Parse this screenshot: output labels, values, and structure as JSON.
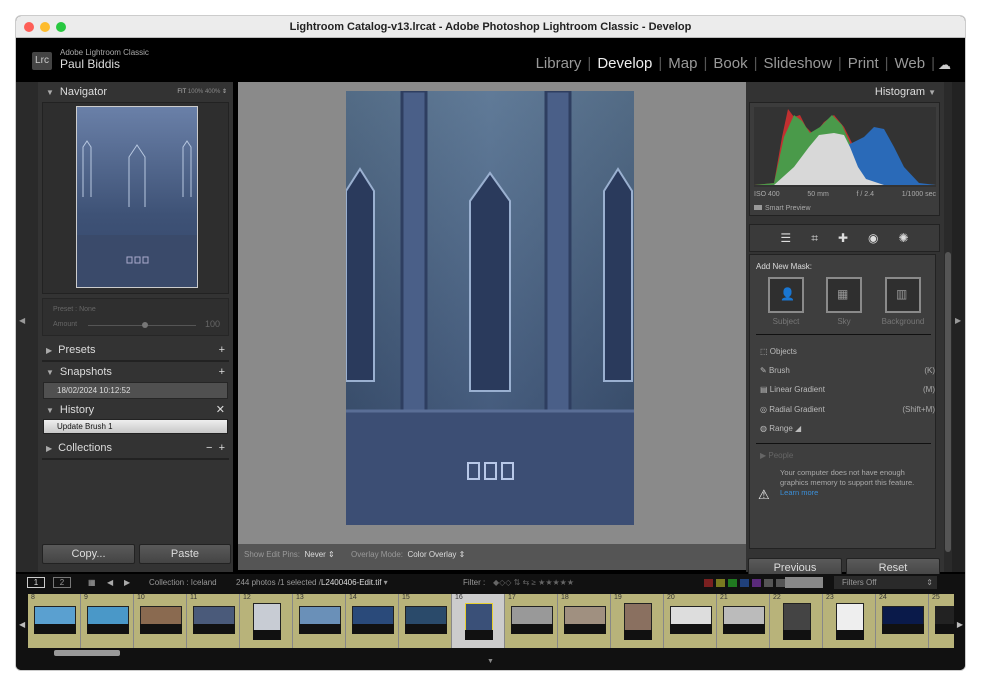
{
  "window": {
    "title": "Lightroom Catalog-v13.lrcat - Adobe Photoshop Lightroom Classic - Develop"
  },
  "identity": {
    "logo": "Lrc",
    "brand": "Adobe Lightroom Classic",
    "user": "Paul Biddis"
  },
  "modules": [
    {
      "label": "Library"
    },
    {
      "label": "Develop",
      "active": true
    },
    {
      "label": "Map"
    },
    {
      "label": "Book"
    },
    {
      "label": "Slideshow"
    },
    {
      "label": "Print"
    },
    {
      "label": "Web"
    }
  ],
  "left": {
    "navigator": {
      "title": "Navigator",
      "zoom": [
        "FIT",
        "100%",
        "400%"
      ]
    },
    "preset": {
      "label": "Preset : None",
      "amount_label": "Amount",
      "amount": "100",
      "amount_fraction": 0.5
    },
    "presets": {
      "title": "Presets"
    },
    "snapshots": {
      "title": "Snapshots",
      "items": [
        "18/02/2024 10:12:52"
      ]
    },
    "history": {
      "title": "History",
      "items": [
        "Update Brush 1"
      ]
    },
    "collections": {
      "title": "Collections"
    },
    "copy": "Copy...",
    "paste": "Paste"
  },
  "toolbar": {
    "pins_label": "Show Edit Pins:",
    "pins_value": "Never",
    "overlay_label": "Overlay Mode:",
    "overlay_value": "Color Overlay"
  },
  "right": {
    "histogram": {
      "title": "Histogram",
      "iso": "ISO 400",
      "focal": "50 mm",
      "aperture": "f / 2.4",
      "shutter": "1/1000 sec",
      "smart_preview": "Smart Preview"
    },
    "mask": {
      "title": "Add New Mask:",
      "quick": [
        "Subject",
        "Sky",
        "Background"
      ],
      "tools": [
        {
          "label": "Objects",
          "key": ""
        },
        {
          "label": "Brush",
          "key": "(K)"
        },
        {
          "label": "Linear Gradient",
          "key": "(M)"
        },
        {
          "label": "Radial Gradient",
          "key": "(Shift+M)"
        },
        {
          "label": "Range",
          "key": ""
        }
      ],
      "people": "People",
      "warning": "Your computer does not have enough graphics memory to support this feature.",
      "learn_more": "Learn more"
    },
    "previous": "Previous",
    "reset": "Reset"
  },
  "filmbar": {
    "views": [
      "1",
      "2"
    ],
    "collection": "Collection : Iceland",
    "count": "244 photos /1 selected /",
    "file": "L2400406-Edit.tif",
    "filter_label": "Filter :",
    "filters_off": "Filters Off",
    "label_colors": [
      "#7a2020",
      "#7a7a20",
      "#207a20",
      "#20407a",
      "#5a2a7a",
      "#555",
      "#555"
    ]
  },
  "filmstrip": {
    "selected": "16",
    "items": [
      {
        "n": "8",
        "c": "#5aa0d0"
      },
      {
        "n": "9",
        "c": "#4a98c8"
      },
      {
        "n": "10",
        "c": "#8a6a50"
      },
      {
        "n": "11",
        "c": "#4a5a7a"
      },
      {
        "n": "12",
        "c": "#c8ccd4"
      },
      {
        "n": "13",
        "c": "#6a90b8"
      },
      {
        "n": "14",
        "c": "#2a4a7a"
      },
      {
        "n": "15",
        "c": "#2a4a6a"
      },
      {
        "n": "16",
        "c": "#3a5078"
      },
      {
        "n": "17",
        "c": "#999"
      },
      {
        "n": "18",
        "c": "#a09080"
      },
      {
        "n": "19",
        "c": "#8a7060"
      },
      {
        "n": "20",
        "c": "#ddd"
      },
      {
        "n": "21",
        "c": "#bbb"
      },
      {
        "n": "22",
        "c": "#444"
      },
      {
        "n": "23",
        "c": "#eee"
      },
      {
        "n": "24",
        "c": "#0a1a4a"
      },
      {
        "n": "25",
        "c": "#222"
      }
    ]
  }
}
